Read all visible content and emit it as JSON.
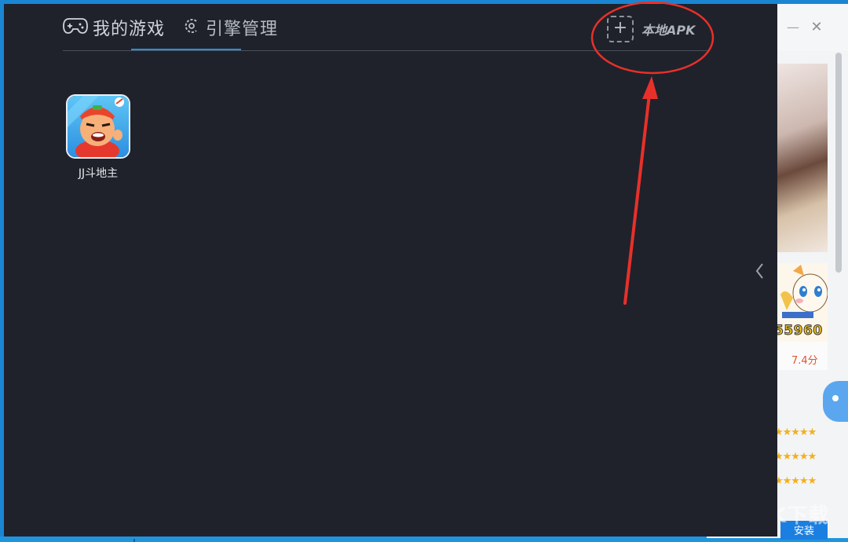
{
  "tabs": {
    "my_games": "我的游戏",
    "engine": "引擎管理"
  },
  "toolbar": {
    "local_apk_label": "本地APK",
    "plus_glyph": "+"
  },
  "games": [
    {
      "name": "JJ斗地主"
    }
  ],
  "background_window": {
    "minimize_glyph": "—",
    "close_glyph": "✕",
    "code_text": "55960",
    "rating": "7.4分",
    "install_label": "安装",
    "watermark": "KK下载"
  },
  "colors": {
    "panel_bg": "#1f222b",
    "accent_blue": "#2a8ee0",
    "annotation_red": "#e8302a",
    "desktop_blue": "#1a86d2"
  },
  "icons": [
    "gamepad-icon",
    "engine-icon",
    "add-dashed-icon",
    "chevron-left-icon"
  ]
}
